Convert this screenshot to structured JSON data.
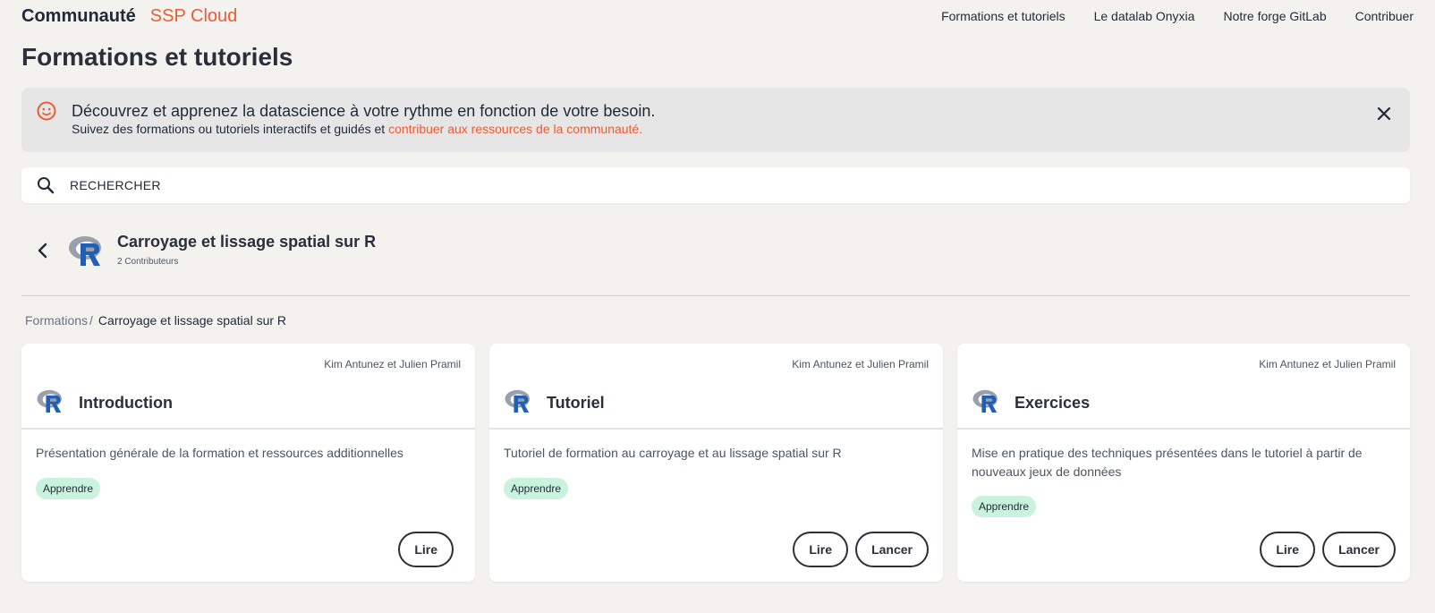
{
  "header": {
    "brand": "Communauté",
    "brand_accent": "SSP Cloud",
    "nav": [
      "Formations et tutoriels",
      "Le datalab Onyxia",
      "Notre forge GitLab",
      "Contribuer"
    ]
  },
  "page_title": "Formations et tutoriels",
  "banner": {
    "title": "Découvrez et apprenez la datascience à votre rythme en fonction de votre besoin.",
    "subtitle": "Suivez des formations ou tutoriels interactifs et guidés et ",
    "link": "contribuer aux ressources de la communauté."
  },
  "search": {
    "placeholder": "RECHERCHER"
  },
  "course": {
    "title": "Carroyage et lissage spatial sur R",
    "contributors": "2 Contributeurs"
  },
  "breadcrumb": {
    "root": "Formations",
    "separator": "/",
    "current": "Carroyage et lissage spatial sur R"
  },
  "cards": [
    {
      "authors": "Kim Antunez et Julien Pramil",
      "title": "Introduction",
      "description": "Présentation générale de la formation et ressources additionnelles",
      "badge": "Apprendre",
      "read_label": "Lire"
    },
    {
      "authors": "Kim Antunez et Julien Pramil",
      "title": "Tutoriel",
      "description": "Tutoriel de formation au carroyage et au lissage spatial sur R",
      "badge": "Apprendre",
      "read_label": "Lire",
      "launch_label": "Lancer"
    },
    {
      "authors": "Kim Antunez et Julien Pramil",
      "title": "Exercices",
      "description": "Mise en pratique des techniques présentées dans le tutoriel à partir de nouveaux jeux de données",
      "badge": "Apprendre",
      "read_label": "Lire",
      "launch_label": "Lancer"
    }
  ],
  "icons": {
    "banner": "smiley-icon",
    "close": "close-icon",
    "search": "search-icon",
    "back": "chevron-left-icon",
    "logo": "r-logo-icon"
  },
  "colors": {
    "accent": "#f05a32",
    "background": "#f3f2ef",
    "badge": "#c9f3dc",
    "text": "#2a2f3a"
  }
}
